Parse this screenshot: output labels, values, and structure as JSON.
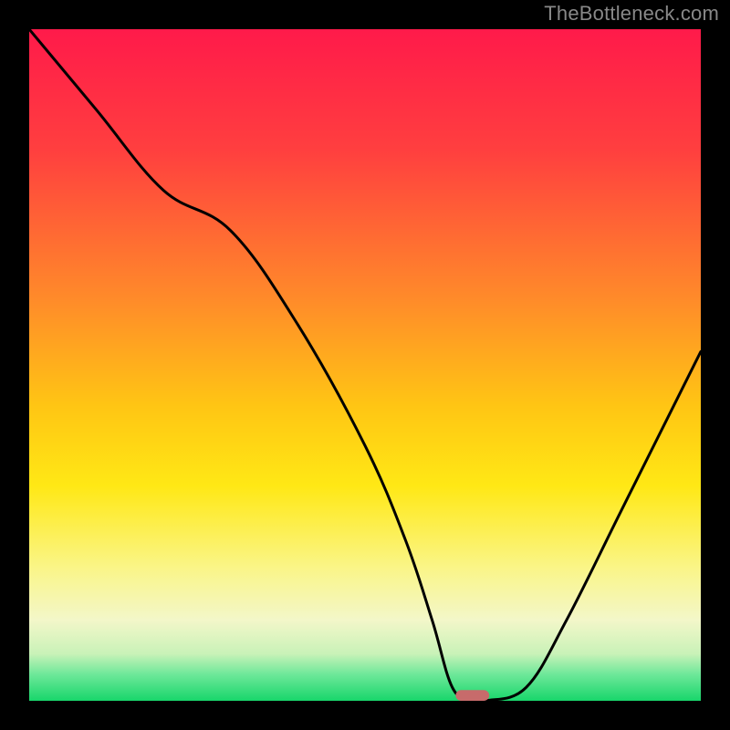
{
  "watermark": "TheBottleneck.com",
  "chart_data": {
    "type": "line",
    "title": "",
    "xlabel": "",
    "ylabel": "",
    "xlim": [
      0,
      100
    ],
    "ylim": [
      0,
      100
    ],
    "series": [
      {
        "name": "bottleneck-curve",
        "x": [
          0,
          10,
          20,
          30,
          40,
          50,
          56,
          60,
          63,
          66,
          68,
          74,
          80,
          88,
          96,
          100
        ],
        "y": [
          100,
          88,
          76,
          70,
          56,
          38,
          24,
          12,
          2,
          0,
          0,
          2,
          12,
          28,
          44,
          52
        ]
      }
    ],
    "marker": {
      "name": "optimal-marker",
      "x": 66,
      "y": 0,
      "width": 5,
      "height": 1.6,
      "color": "#c76b6b"
    },
    "gradient_stops": [
      {
        "offset": 0,
        "color": "#ff1a4a"
      },
      {
        "offset": 18,
        "color": "#ff3f3f"
      },
      {
        "offset": 40,
        "color": "#ff8a2a"
      },
      {
        "offset": 56,
        "color": "#ffc514"
      },
      {
        "offset": 68,
        "color": "#ffe815"
      },
      {
        "offset": 80,
        "color": "#faf586"
      },
      {
        "offset": 88,
        "color": "#f3f7c9"
      },
      {
        "offset": 93,
        "color": "#c9f2b8"
      },
      {
        "offset": 96,
        "color": "#6fe89a"
      },
      {
        "offset": 100,
        "color": "#18d66b"
      }
    ]
  }
}
